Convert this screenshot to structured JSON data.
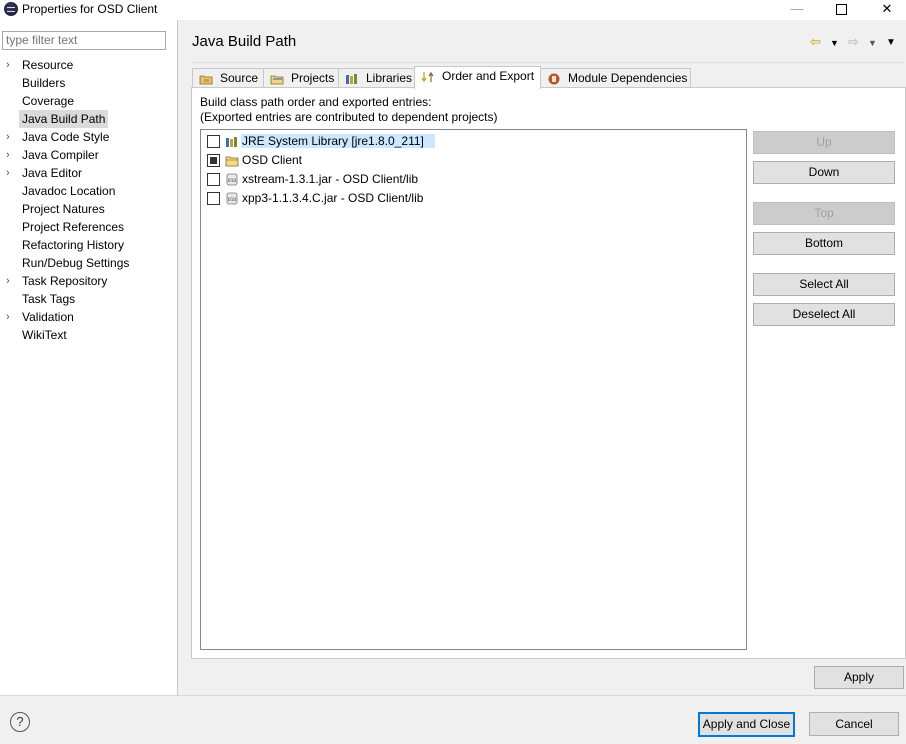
{
  "window": {
    "title": "Properties for OSD Client"
  },
  "filter": {
    "placeholder": "type filter text"
  },
  "tree": [
    {
      "label": "Resource",
      "expandable": true
    },
    {
      "label": "Builders",
      "expandable": false
    },
    {
      "label": "Coverage",
      "expandable": false
    },
    {
      "label": "Java Build Path",
      "expandable": false,
      "selected": true
    },
    {
      "label": "Java Code Style",
      "expandable": true
    },
    {
      "label": "Java Compiler",
      "expandable": true
    },
    {
      "label": "Java Editor",
      "expandable": true
    },
    {
      "label": "Javadoc Location",
      "expandable": false
    },
    {
      "label": "Project Natures",
      "expandable": false
    },
    {
      "label": "Project References",
      "expandable": false
    },
    {
      "label": "Refactoring History",
      "expandable": false
    },
    {
      "label": "Run/Debug Settings",
      "expandable": false
    },
    {
      "label": "Task Repository",
      "expandable": true
    },
    {
      "label": "Task Tags",
      "expandable": false
    },
    {
      "label": "Validation",
      "expandable": true
    },
    {
      "label": "WikiText",
      "expandable": false
    }
  ],
  "page": {
    "title": "Java Build Path"
  },
  "tabs": [
    {
      "label": "Source",
      "icon": "source-folder-icon"
    },
    {
      "label": "Projects",
      "icon": "projects-icon"
    },
    {
      "label": "Libraries",
      "icon": "libraries-icon"
    },
    {
      "label": "Order and Export",
      "icon": "order-export-icon",
      "active": true
    },
    {
      "label": "Module Dependencies",
      "icon": "module-icon"
    }
  ],
  "order_export": {
    "desc_line1": "Build class path order and exported entries:",
    "desc_line2": "(Exported entries are contributed to dependent projects)",
    "entries": [
      {
        "label": "JRE System Library [jre1.8.0_211]",
        "checked": false,
        "icon": "library-icon",
        "selected": true
      },
      {
        "label": "OSD Client",
        "checked": true,
        "icon": "folder-icon",
        "selected": false
      },
      {
        "label": "xstream-1.3.1.jar - OSD Client/lib",
        "checked": false,
        "icon": "jar-icon",
        "selected": false
      },
      {
        "label": "xpp3-1.1.3.4.C.jar - OSD Client/lib",
        "checked": false,
        "icon": "jar-icon",
        "selected": false
      }
    ],
    "buttons": {
      "up": "Up",
      "down": "Down",
      "top": "Top",
      "bottom": "Bottom",
      "select_all": "Select All",
      "deselect_all": "Deselect All"
    }
  },
  "apply": "Apply",
  "footer": {
    "apply_close": "Apply and Close",
    "cancel": "Cancel"
  },
  "colors": {
    "selection": "#cce8ff",
    "focus": "#0078d7",
    "tree_selection": "#dadada"
  }
}
